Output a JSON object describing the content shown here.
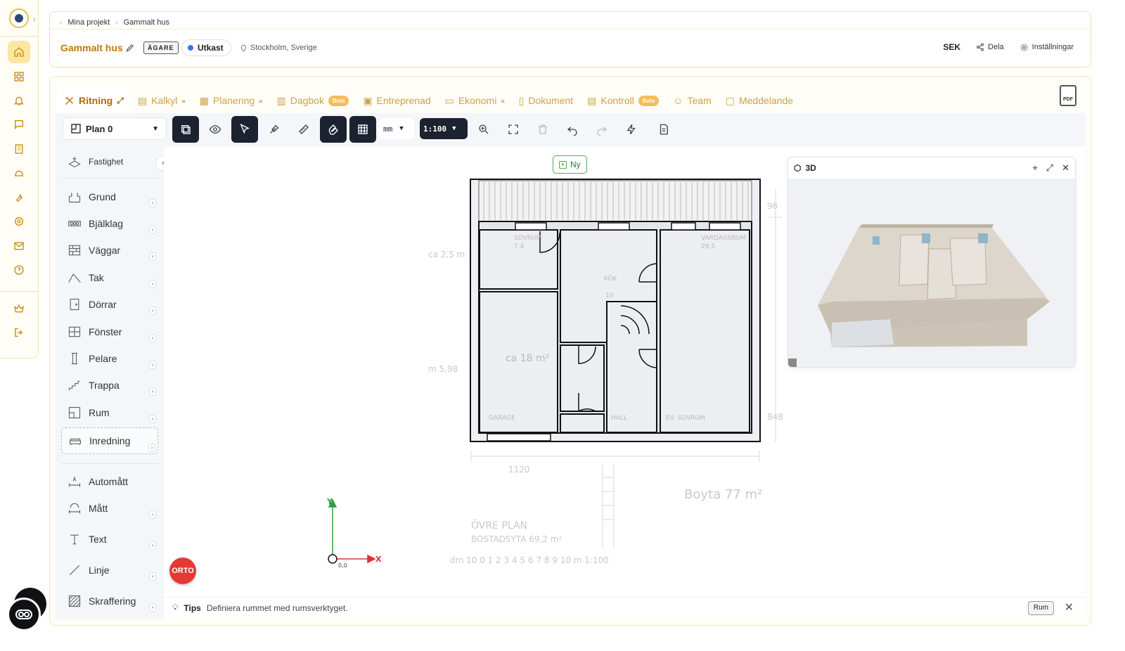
{
  "breadcrumb": {
    "parent": "Mina projekt",
    "current": "Gammalt hus"
  },
  "project": {
    "title": "Gammalt hus",
    "role_badge": "ÄGARE",
    "status": "Utkast",
    "location": "Stockholm, Sverige"
  },
  "header_actions": {
    "currency": "SEK",
    "share": "Dela",
    "settings": "Inställningar"
  },
  "tabs": [
    {
      "label": "Ritning",
      "icon": "ruler-pencil-icon",
      "active": true,
      "locked": false,
      "beta": false
    },
    {
      "label": "Kalkyl",
      "icon": "calculator-icon",
      "locked": true,
      "beta": false
    },
    {
      "label": "Planering",
      "icon": "calendar-icon",
      "locked": true,
      "beta": false
    },
    {
      "label": "Dagbok",
      "icon": "book-icon",
      "locked": false,
      "beta": true
    },
    {
      "label": "Entreprenad",
      "icon": "building-icon",
      "locked": false,
      "beta": false
    },
    {
      "label": "Ekonomi",
      "icon": "wallet-icon",
      "locked": true,
      "beta": false
    },
    {
      "label": "Dokument",
      "icon": "document-icon",
      "locked": false,
      "beta": false
    },
    {
      "label": "Kontroll",
      "icon": "clipboard-icon",
      "locked": false,
      "beta": true
    },
    {
      "label": "Team",
      "icon": "users-icon",
      "locked": false,
      "beta": false
    },
    {
      "label": "Meddelande",
      "icon": "chat-icon",
      "locked": false,
      "beta": false
    }
  ],
  "beta_label": "Beta",
  "pdf_label": "PDF",
  "toolbar": {
    "plan": "Plan 0",
    "unit": "mm",
    "scale": "1:100"
  },
  "palette": {
    "property": "Fastighet",
    "items": [
      "Grund",
      "Bjälklag",
      "Väggar",
      "Tak",
      "Dörrar",
      "Fönster",
      "Pelare",
      "Trappa",
      "Rum",
      "Inredning"
    ],
    "tools": [
      "Automått",
      "Mått",
      "Text",
      "Linje",
      "Skraffering"
    ]
  },
  "canvas": {
    "new_button": "Ny",
    "orto": "ORTO",
    "axis_x": "X",
    "axis_y": "Y",
    "origin": "0,0",
    "scan_text": {
      "left_dim": "ca 2,5 m",
      "room_sovrum": "SOVRUM",
      "room_sovrum_area": "7,4",
      "room_vardagsrum": "VARDAGSRUM",
      "room_vardagsrum_area": "29,5",
      "room_kok": "KÖK",
      "room_kok_area": "10",
      "room_garage": "GARAGE",
      "room_hall": "HALL",
      "room_ev_sovrum": "EV. SOVRUM",
      "garage_area": "ca 18 m²",
      "dim_left": "m 5,98",
      "dim_96": "96",
      "dim_848": "848",
      "dim_1120": "1120",
      "boyta": "Boyta  77 m²",
      "ovre_plan": "ÖVRE PLAN",
      "bostadsyta": "BOSTADSYTA 69,2 m²",
      "scale_bar": "dm 10   0   1   2   3   4   5   6   7   8   9   10 m   1:100"
    }
  },
  "panel3d": {
    "title": "3D"
  },
  "tips": {
    "label": "Tips",
    "text": "Definiera rummet med rumsverktyget.",
    "button": "Rum"
  },
  "colors": {
    "accent": "#c07a0a",
    "beta": "#f5a623",
    "dark": "#1d2230",
    "orto": "#e53935",
    "new": "#4caf50"
  }
}
